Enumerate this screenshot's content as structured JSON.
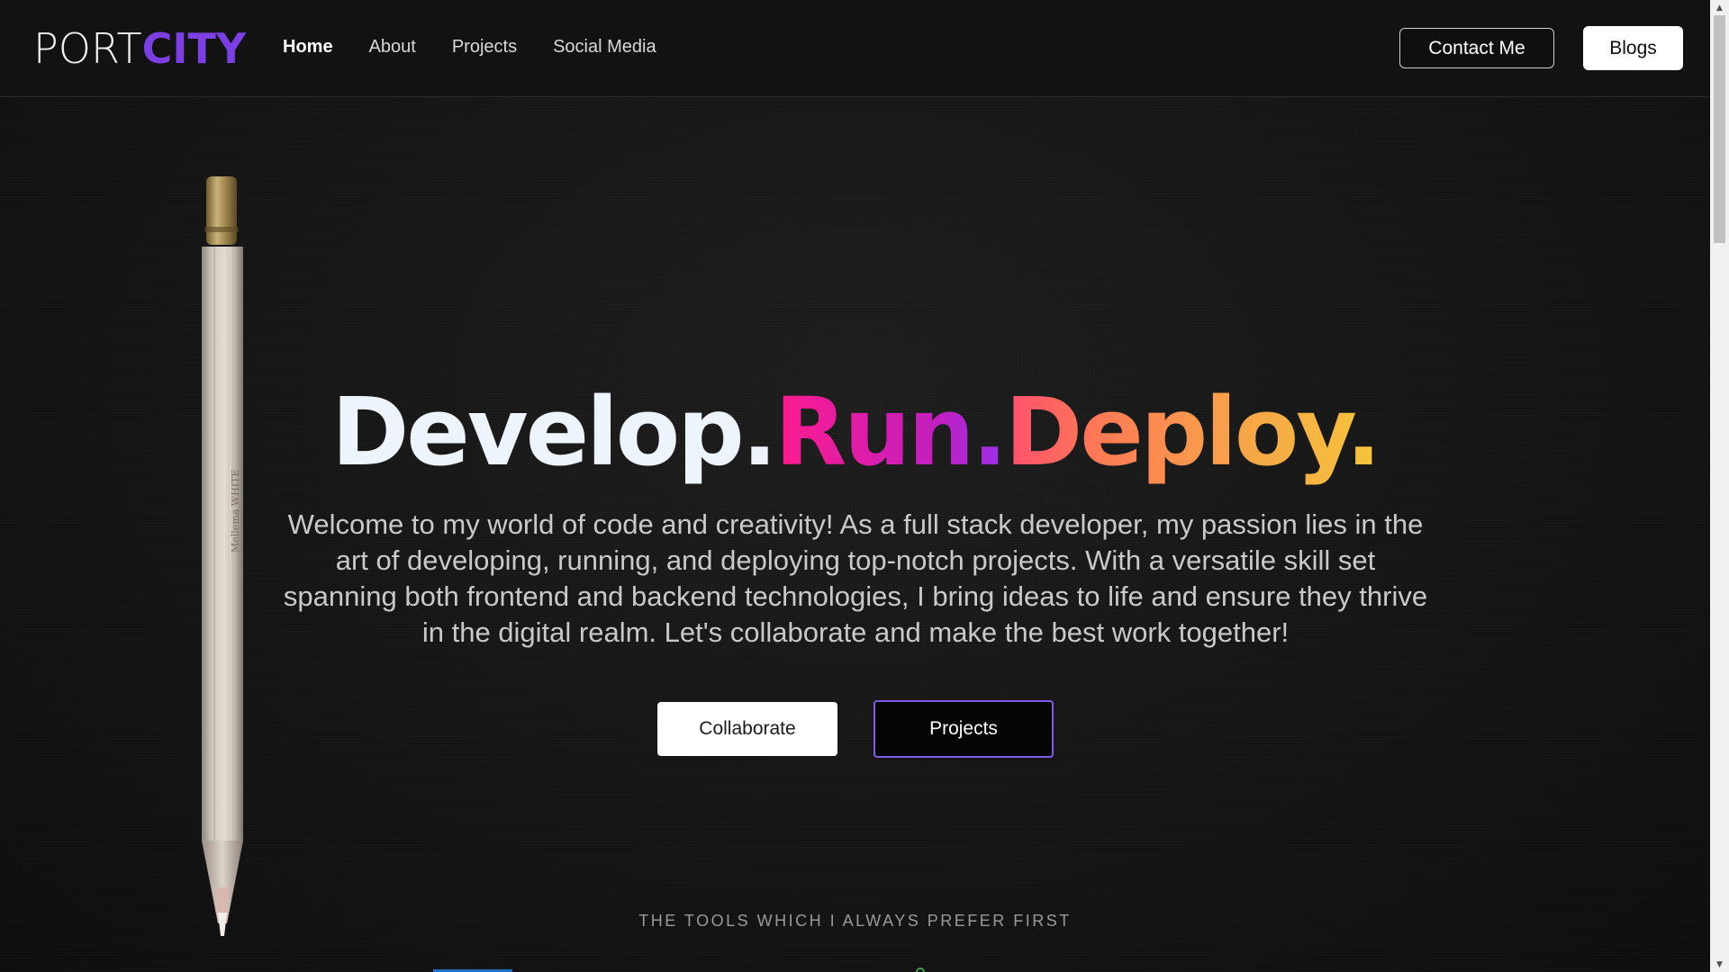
{
  "navbar": {
    "logo": {
      "part1": "PORT",
      "part2": "CITY"
    },
    "links": [
      {
        "label": "Home",
        "active": true
      },
      {
        "label": "About",
        "active": false
      },
      {
        "label": "Projects",
        "active": false
      },
      {
        "label": "Social Media",
        "active": false
      }
    ],
    "contact_label": "Contact Me",
    "blogs_label": "Blogs"
  },
  "hero": {
    "title": {
      "develop": "Develop.",
      "run": "Run.",
      "deploy": "Deploy."
    },
    "description": "Welcome to my world of code and creativity! As a full stack developer, my passion lies in the art of developing, running, and deploying top-notch projects. With a versatile skill set spanning both frontend and backend technologies, I bring ideas to life and ensure they thrive in the digital realm. Let's collaborate and make the best work together!",
    "collaborate_label": "Collaborate",
    "projects_label": "Projects"
  },
  "tools": {
    "heading": "THE TOOLS WHICH I ALWAYS PREFER FIRST"
  },
  "colors": {
    "logo_accent": "#7b3fe4",
    "run_gradient": [
      "#ff1b8d",
      "#9b30e8"
    ],
    "deploy_gradient": [
      "#ff4f70",
      "#f5c53a"
    ],
    "projects_border": "#7b5be8"
  },
  "icons": {
    "scroll_up": "▲",
    "scroll_down": "▼"
  }
}
